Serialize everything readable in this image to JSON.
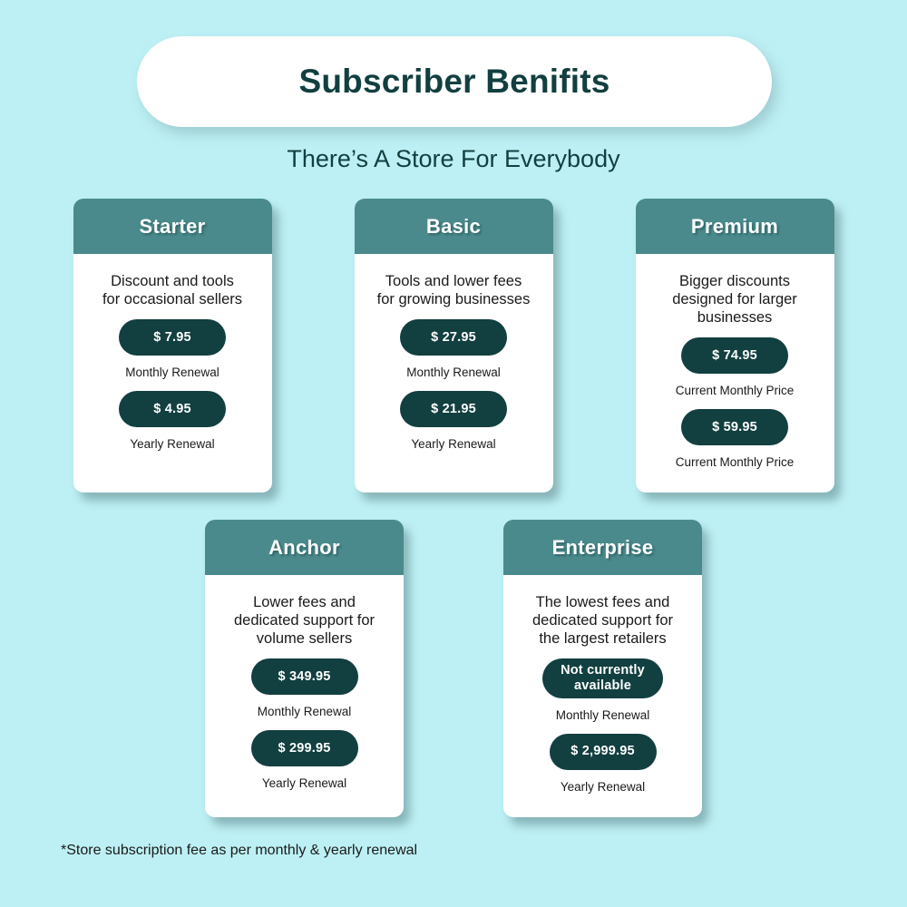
{
  "colors": {
    "background": "#bdf0f4",
    "header_teal": "#4a8a8c",
    "dark_teal": "#123f40",
    "card_white": "#ffffff",
    "body_text": "#1a1a1a"
  },
  "header": {
    "title": "Subscriber Benifits",
    "subtitle": "There’s A Store For Everybody"
  },
  "footnote": "*Store subscription fee as per monthly & yearly renewal",
  "plans": {
    "top_row": [
      {
        "name": "Starter",
        "description": "Discount and tools\nfor occasional sellers",
        "primary_price": "$ 7.95",
        "primary_label": "Monthly Renewal",
        "secondary_price": "$ 4.95",
        "secondary_label": "Yearly Renewal"
      },
      {
        "name": "Basic",
        "description": "Tools and lower fees\nfor growing businesses",
        "primary_price": "$ 27.95",
        "primary_label": "Monthly Renewal",
        "secondary_price": "$ 21.95",
        "secondary_label": "Yearly Renewal"
      },
      {
        "name": "Premium",
        "description": "Bigger discounts\ndesigned for larger\nbusinesses",
        "primary_price": "$ 74.95",
        "primary_label": "Current Monthly Price",
        "secondary_price": "$ 59.95",
        "secondary_label": "Current Monthly Price"
      }
    ],
    "bottom_row": [
      {
        "name": "Anchor",
        "description": "Lower fees and\ndedicated support for\nvolume sellers",
        "primary_price": "$ 349.95",
        "primary_label": "Monthly Renewal",
        "secondary_price": "$ 299.95",
        "secondary_label": "Yearly Renewal"
      },
      {
        "name": "Enterprise",
        "description": "The lowest fees and\ndedicated support for\nthe largest retailers",
        "primary_price": "Not currently\navailable",
        "primary_label": "Monthly Renewal",
        "secondary_price": "$ 2,999.95",
        "secondary_label": "Yearly Renewal"
      }
    ]
  }
}
